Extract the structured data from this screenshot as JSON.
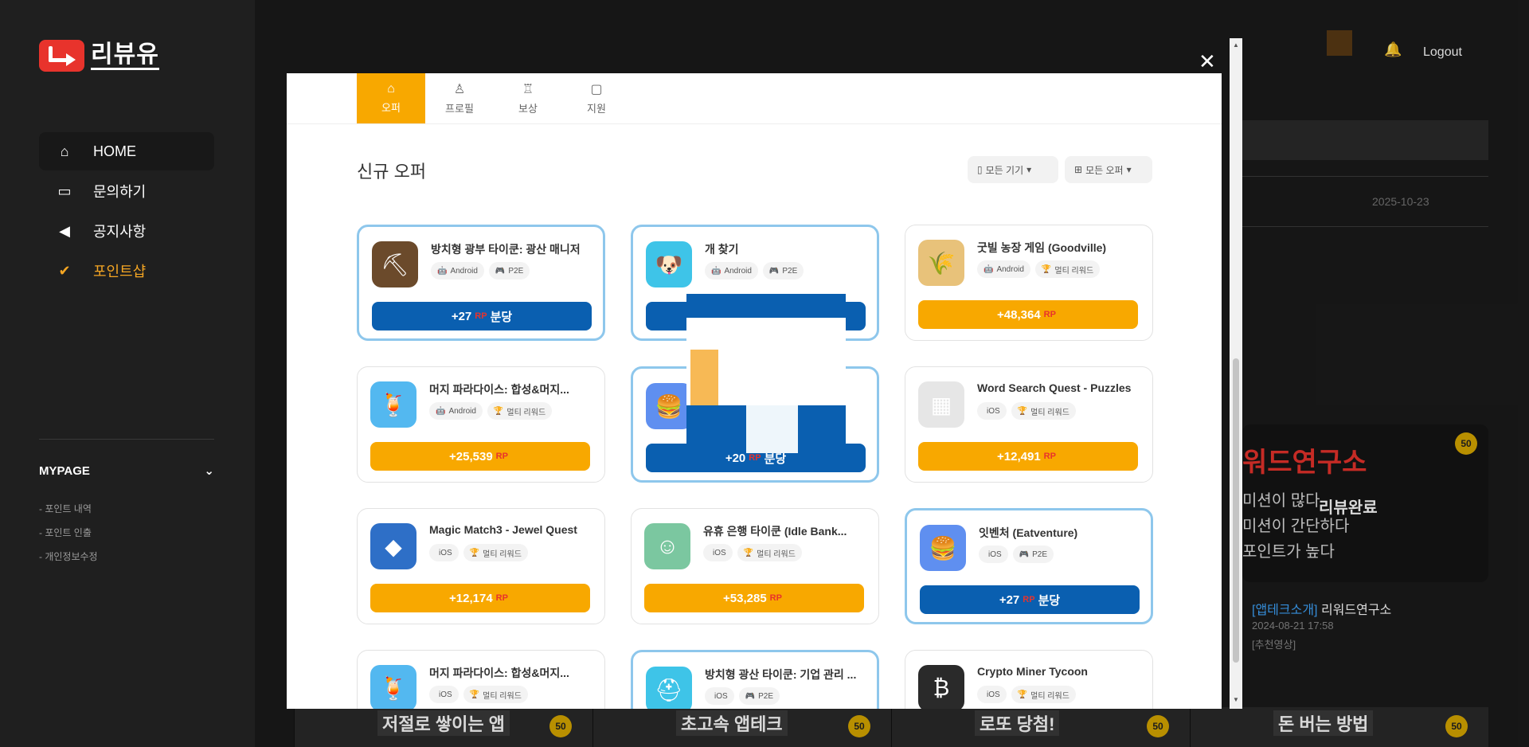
{
  "sidebar": {
    "logo_text": "리뷰유",
    "nav": [
      {
        "label": "HOME",
        "icon": "home-icon"
      },
      {
        "label": "문의하기",
        "icon": "chat-icon"
      },
      {
        "label": "공지사항",
        "icon": "megaphone-icon"
      },
      {
        "label": "포인트샵",
        "icon": "badge-check-icon"
      }
    ],
    "mypage_label": "MYPAGE",
    "mypage_links": [
      "- 포인트 내역",
      "- 포인트 인출",
      "- 개인정보수정"
    ]
  },
  "header": {
    "logout_label": "Logout"
  },
  "background": {
    "date": "2025-10-23",
    "thumb_title": "워드연구소",
    "thumb_lines": [
      "미션이 많다",
      "미션이 간단하다",
      "포인트가 높다"
    ],
    "thumb_done": "리뷰완료",
    "thumb_badge": "50",
    "post_category": "[앱테크소개]",
    "post_title": "리워드연구소",
    "post_date": "2024-08-21 17:58",
    "post_tag": "[추천영상]",
    "strip": [
      {
        "text": "저절로 쌓이는 앱",
        "badge": "50"
      },
      {
        "text": "초고속 앱테크",
        "badge": "50"
      },
      {
        "text": "로또 당첨!",
        "badge": "50"
      },
      {
        "text": "돈 버는 방법",
        "badge": "50"
      }
    ]
  },
  "modal": {
    "tabs": [
      {
        "label": "오퍼",
        "icon": "home-icon"
      },
      {
        "label": "프로필",
        "icon": "user-icon"
      },
      {
        "label": "보상",
        "icon": "trophy-icon"
      },
      {
        "label": "지원",
        "icon": "chat-icon"
      }
    ],
    "section_title": "신규 오퍼",
    "filter_device": "모든 기기",
    "filter_offer": "모든 오퍼",
    "rp_label": "RP",
    "cards": [
      {
        "name": "방치형 광부 타이쿤: 광산 매니저",
        "tags": [
          "Android",
          "P2E"
        ],
        "reward": "+27",
        "suffix": "분당",
        "style": "blue",
        "highlight": true
      },
      {
        "name": "개 찾기",
        "tags": [
          "Android",
          "P2E"
        ],
        "reward": "",
        "suffix": "",
        "style": "blue",
        "highlight": true
      },
      {
        "name": "굿빌 농장 게임 (Goodville)",
        "tags": [
          "Android",
          "멀티 리워드"
        ],
        "reward": "+48,364",
        "suffix": "",
        "style": "orange",
        "highlight": false
      },
      {
        "name": "머지 파라다이스: 합성&머지...",
        "tags": [
          "Android",
          "멀티 리워드"
        ],
        "reward": "+25,539",
        "suffix": "",
        "style": "orange",
        "highlight": false
      },
      {
        "name": "",
        "tags": [],
        "reward": "+20",
        "suffix": "분당",
        "style": "blue",
        "highlight": true
      },
      {
        "name": "Word Search Quest - Puzzles",
        "tags": [
          "iOS",
          "멀티 리워드"
        ],
        "reward": "+12,491",
        "suffix": "",
        "style": "orange",
        "highlight": false
      },
      {
        "name": "Magic Match3 - Jewel Quest",
        "tags": [
          "iOS",
          "멀티 리워드"
        ],
        "reward": "+12,174",
        "suffix": "",
        "style": "orange",
        "highlight": false
      },
      {
        "name": "유휴 은행 타이쿤 (Idle Bank...",
        "tags": [
          "iOS",
          "멀티 리워드"
        ],
        "reward": "+53,285",
        "suffix": "",
        "style": "orange",
        "highlight": false
      },
      {
        "name": "잇벤처 (Eatventure)",
        "tags": [
          "iOS",
          "P2E"
        ],
        "reward": "+27",
        "suffix": "분당",
        "style": "blue",
        "highlight": true
      },
      {
        "name": "머지 파라다이스: 합성&머지...",
        "tags": [
          "iOS",
          "멀티 리워드"
        ],
        "reward": "",
        "suffix": "",
        "style": "orange",
        "highlight": false
      },
      {
        "name": "방치형 광산 타이쿤: 기업 관리 ...",
        "tags": [
          "iOS",
          "P2E"
        ],
        "reward": "",
        "suffix": "",
        "style": "blue",
        "highlight": true
      },
      {
        "name": "Crypto Miner Tycoon",
        "tags": [
          "iOS",
          "멀티 리워드"
        ],
        "reward": "",
        "suffix": "",
        "style": "orange",
        "highlight": false
      }
    ],
    "card_icons": [
      "pickaxe-icon",
      "dog-icon",
      "farm-icon",
      "cocktail-icon",
      "burger-icon",
      "word-grid-icon",
      "jewel-icon",
      "banker-icon",
      "burger-icon",
      "cocktail-icon",
      "miner-icon",
      "bitcoin-icon"
    ]
  }
}
